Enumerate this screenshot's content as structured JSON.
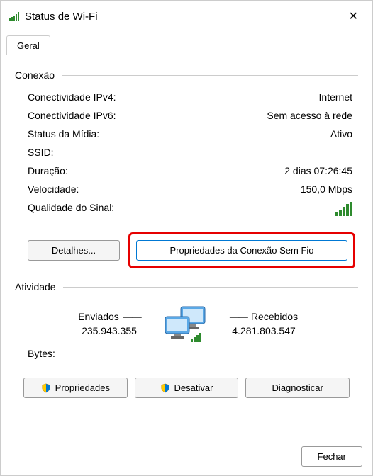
{
  "window": {
    "title": "Status de Wi-Fi",
    "close_icon": "✕"
  },
  "tabs": {
    "general": "Geral"
  },
  "connection": {
    "section": "Conexão",
    "ipv4_label": "Conectividade IPv4:",
    "ipv4_value": "Internet",
    "ipv6_label": "Conectividade IPv6:",
    "ipv6_value": "Sem acesso à rede",
    "media_label": "Status da Mídia:",
    "media_value": "Ativo",
    "ssid_label": "SSID:",
    "ssid_value": "",
    "duration_label": "Duração:",
    "duration_value": "2 dias 07:26:45",
    "speed_label": "Velocidade:",
    "speed_value": "150,0 Mbps",
    "signal_label": "Qualidade do Sinal:"
  },
  "buttons": {
    "details": "Detalhes...",
    "wireless_props": "Propriedades da Conexão Sem Fio",
    "properties": "Propriedades",
    "disable": "Desativar",
    "diagnose": "Diagnosticar",
    "close": "Fechar"
  },
  "activity": {
    "section": "Atividade",
    "sent_label": "Enviados",
    "received_label": "Recebidos",
    "sent_value": "235.943.355",
    "received_value": "4.281.803.547",
    "bytes_label": "Bytes:"
  }
}
